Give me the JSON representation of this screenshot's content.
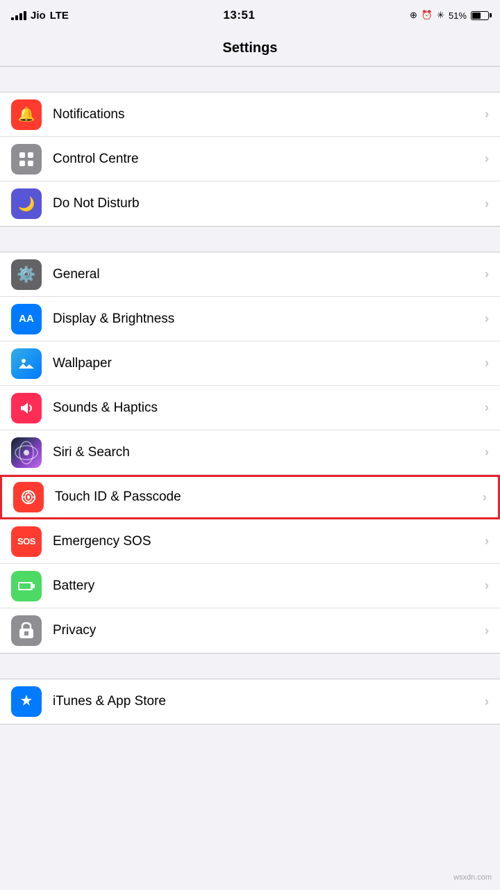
{
  "statusBar": {
    "carrier": "Jio",
    "network": "LTE",
    "time": "13:51",
    "battery": "51%"
  },
  "header": {
    "title": "Settings"
  },
  "sections": [
    {
      "id": "notifications-section",
      "items": [
        {
          "id": "notifications",
          "label": "Notifications",
          "iconBg": "icon-red",
          "iconSymbol": "🔔",
          "highlighted": false
        },
        {
          "id": "control-centre",
          "label": "Control Centre",
          "iconBg": "icon-gray",
          "iconSymbol": "⊟",
          "highlighted": false
        },
        {
          "id": "do-not-disturb",
          "label": "Do Not Disturb",
          "iconBg": "icon-purple",
          "iconSymbol": "🌙",
          "highlighted": false
        }
      ]
    },
    {
      "id": "display-section",
      "items": [
        {
          "id": "general",
          "label": "General",
          "iconBg": "icon-dark-gray",
          "iconSymbol": "⚙️",
          "highlighted": false
        },
        {
          "id": "display-brightness",
          "label": "Display & Brightness",
          "iconBg": "icon-blue",
          "iconSymbol": "AA",
          "highlighted": false
        },
        {
          "id": "wallpaper",
          "label": "Wallpaper",
          "iconBg": "icon-teal",
          "iconSymbol": "✿",
          "highlighted": false
        },
        {
          "id": "sounds-haptics",
          "label": "Sounds & Haptics",
          "iconBg": "icon-pink",
          "iconSymbol": "🔊",
          "highlighted": false
        },
        {
          "id": "siri-search",
          "label": "Siri & Search",
          "iconBg": "icon-siri",
          "iconSymbol": "◉",
          "highlighted": false
        },
        {
          "id": "touch-id",
          "label": "Touch ID & Passcode",
          "iconBg": "icon-touch",
          "iconSymbol": "👆",
          "highlighted": true
        },
        {
          "id": "emergency-sos",
          "label": "Emergency SOS",
          "iconBg": "icon-sos",
          "iconSymbol": "SOS",
          "highlighted": false
        },
        {
          "id": "battery",
          "label": "Battery",
          "iconBg": "icon-battery",
          "iconSymbol": "🔋",
          "highlighted": false
        },
        {
          "id": "privacy",
          "label": "Privacy",
          "iconBg": "icon-privacy",
          "iconSymbol": "✋",
          "highlighted": false
        }
      ]
    },
    {
      "id": "appstore-section",
      "items": [
        {
          "id": "itunes-appstore",
          "label": "iTunes & App Store",
          "iconBg": "icon-appstore",
          "iconSymbol": "A",
          "highlighted": false
        }
      ]
    }
  ],
  "chevron": "›",
  "watermark": "wsxdn.com"
}
